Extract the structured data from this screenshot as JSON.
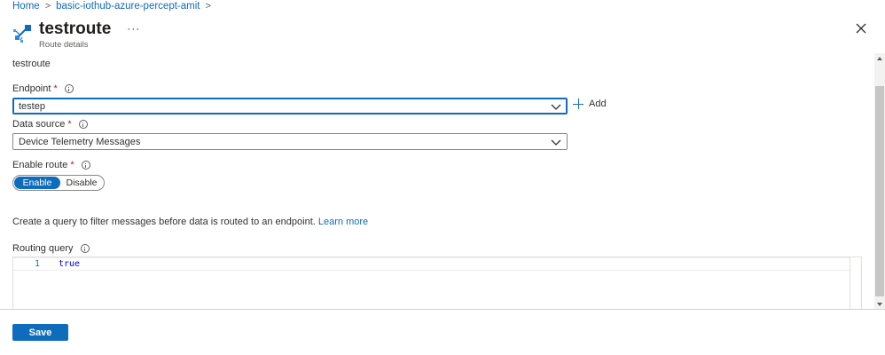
{
  "breadcrumb": {
    "items": [
      "Home",
      "basic-iothub-azure-percept-amit"
    ],
    "separator": ">"
  },
  "header": {
    "title": "testroute",
    "subtitle": "Route details",
    "more_label": "···",
    "icon": "route-icon",
    "close_icon": "close-icon"
  },
  "form": {
    "route_name": "testroute",
    "endpoint": {
      "label": "Endpoint",
      "required_mark": "*",
      "value": "testep",
      "add_label": "Add"
    },
    "data_source": {
      "label": "Data source",
      "required_mark": "*",
      "value": "Device Telemetry Messages"
    },
    "enable_route": {
      "label": "Enable route",
      "required_mark": "*",
      "options": [
        "Enable",
        "Disable"
      ],
      "selected": "Enable"
    },
    "query_description": "Create a query to filter messages before data is routed to an endpoint.",
    "learn_more_label": "Learn more",
    "routing_query": {
      "label": "Routing query",
      "line_number": "1",
      "code": "true"
    }
  },
  "footer": {
    "save_label": "Save"
  },
  "colors": {
    "accent": "#0f6cbd",
    "required": "#a4262c",
    "code_keyword": "#0000ff"
  }
}
